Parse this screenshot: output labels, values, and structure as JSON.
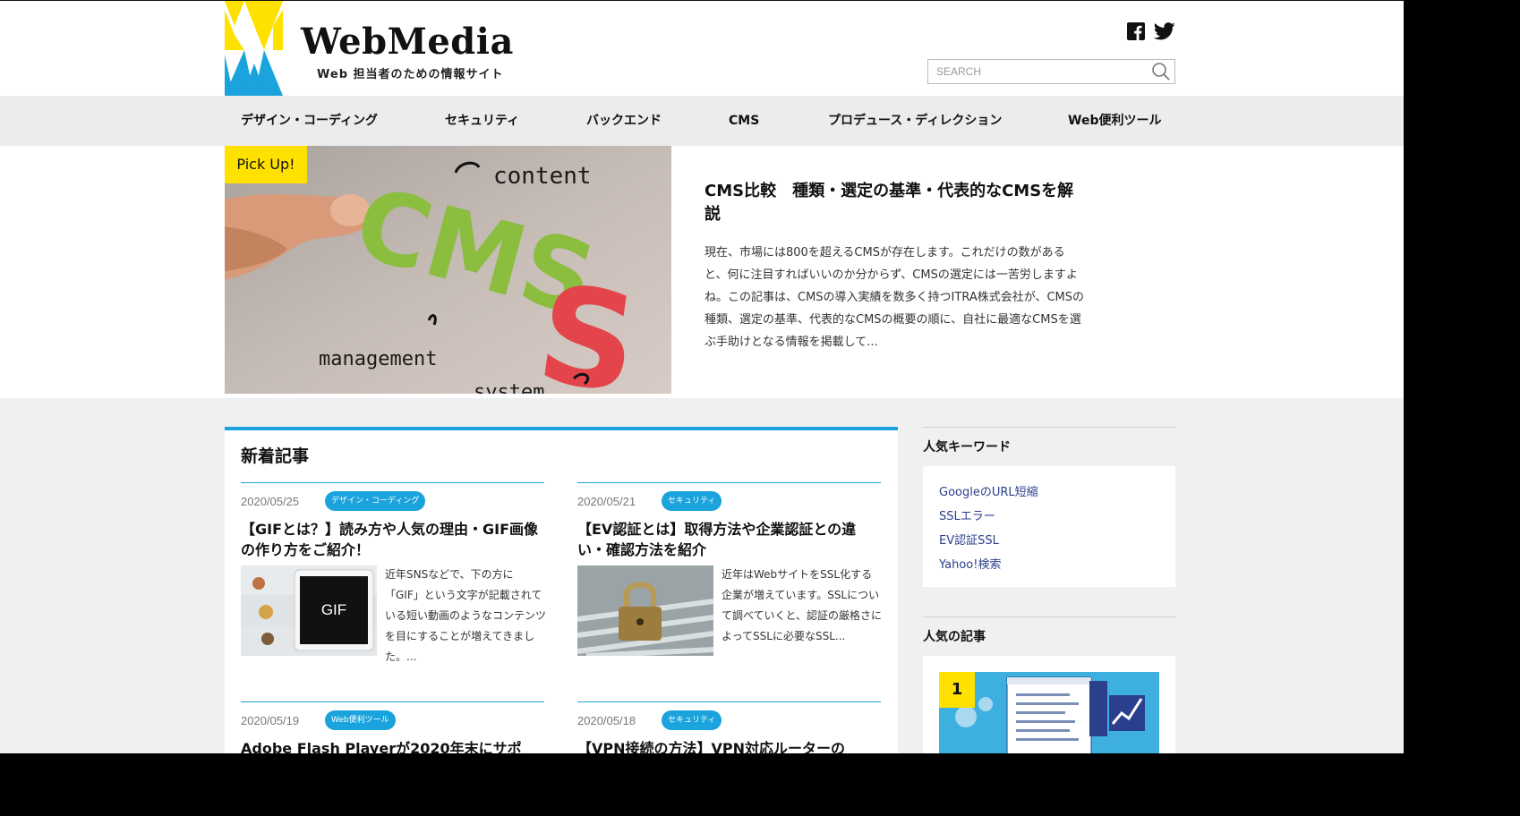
{
  "site": {
    "logo_title": "WebMedia",
    "logo_subtitle": "Web 担当者のための情報サイト",
    "search_placeholder": "SEARCH",
    "social_icons": [
      "facebook-icon",
      "twitter-icon"
    ]
  },
  "nav": {
    "items": [
      {
        "label": "デザイン・コーディング"
      },
      {
        "label": "セキュリティ"
      },
      {
        "label": "バックエンド"
      },
      {
        "label": "CMS"
      },
      {
        "label": "プロデュース・ディレクション"
      },
      {
        "label": "Web便利ツール"
      }
    ]
  },
  "pickup": {
    "badge": "Pick Up!",
    "image_words": [
      "content",
      "management",
      "system"
    ],
    "image_letters": "CMS",
    "title": "CMS比較　種類・選定の基準・代表的なCMSを解説",
    "text": "現在、市場には800を超えるCMSが存在します。これだけの数があると、何に注目すればいいのか分からず、CMSの選定には一苦労しますよね。この記事は、CMSの導入実績を数多く持つITRA株式会社が、CMSの種類、選定の基準、代表的なCMSの概要の順に、自社に最適なCMSを選ぶ手助けとなる情報を掲載して..."
  },
  "latest": {
    "heading": "新着記事",
    "articles": [
      {
        "date": "2020/05/25",
        "category": "デザイン・コーディング",
        "title": "【GIFとは？】読み方や人気の理由・GIF画像の作り方をご紹介！",
        "thumb_label": "GIF",
        "excerpt": "近年SNSなどで、下の方に「GIF」という文字が記載されている短い動画のようなコンテンツを目にすることが増えてきました。..."
      },
      {
        "date": "2020/05/21",
        "category": "セキュリティ",
        "title": "【EV認証とは】取得方法や企業認証との違い・確認方法を紹介",
        "thumb_label": "",
        "excerpt": "近年はWebサイトをSSL化する企業が増えています。SSLについて調べていくと、認証の厳格さによってSSLに必要なSSL..."
      },
      {
        "date": "2020/05/19",
        "category": "Web便利ツール",
        "title": "Adobe Flash Playerが2020年末にサポ",
        "thumb_label": "",
        "excerpt": ""
      },
      {
        "date": "2020/05/18",
        "category": "セキュリティ",
        "title": "【VPN接続の方法】VPN対応ルーターの",
        "thumb_label": "",
        "excerpt": ""
      }
    ]
  },
  "sidebar": {
    "keywords_heading": "人気キーワード",
    "keywords": [
      "GoogleのURL短縮",
      "SSLエラー",
      "EV認証SSL",
      "Yahoo!検索"
    ],
    "popular_heading": "人気の記事",
    "popular_rank": "1"
  },
  "colors": {
    "accent": "#1aa3dc",
    "badge_yellow": "#ffe100",
    "nav_bg": "#ececec",
    "page_bg": "#f0f0f0",
    "keyword_link": "#2b3f8c"
  }
}
